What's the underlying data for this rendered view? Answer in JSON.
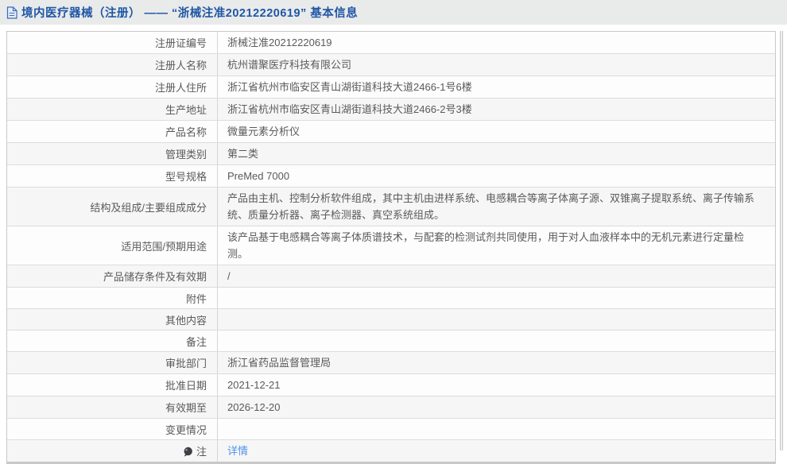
{
  "header": {
    "icon": "document-icon",
    "title": "境内医疗器械（注册） —— “浙械注准20212220619” 基本信息"
  },
  "colors": {
    "header_bg": "#e9eaea",
    "header_text": "#1f57a5",
    "row_even_bg": "#f6f6f7",
    "row_odd_bg": "#fdfdfe",
    "border": "#c9c9c9",
    "text": "#5a5a5a",
    "link": "#4f94e8"
  },
  "table": {
    "rows": [
      {
        "label": "注册证编号",
        "value": "浙械注准20212220619"
      },
      {
        "label": "注册人名称",
        "value": "杭州谱聚医疗科技有限公司"
      },
      {
        "label": "注册人住所",
        "value": "浙江省杭州市临安区青山湖街道科技大道2466-1号6楼"
      },
      {
        "label": "生产地址",
        "value": "浙江省杭州市临安区青山湖街道科技大道2466-2号3楼"
      },
      {
        "label": "产品名称",
        "value": "微量元素分析仪"
      },
      {
        "label": "管理类别",
        "value": "第二类"
      },
      {
        "label": "型号规格",
        "value": "PreMed 7000"
      },
      {
        "label": "结构及组成/主要组成成分",
        "value": "产品由主机、控制分析软件组成，其中主机由进样系统、电感耦合等离子体离子源、双锥离子提取系统、离子传输系统、质量分析器、离子检测器、真空系统组成。"
      },
      {
        "label": "适用范围/预期用途",
        "value": "该产品基于电感耦合等离子体质谱技术，与配套的检测试剂共同使用，用于对人血液样本中的无机元素进行定量检测。"
      },
      {
        "label": "产品储存条件及有效期",
        "value": "/"
      },
      {
        "label": "附件",
        "value": ""
      },
      {
        "label": "其他内容",
        "value": ""
      },
      {
        "label": "备注",
        "value": ""
      },
      {
        "label": "审批部门",
        "value": "浙江省药品监督管理局"
      },
      {
        "label": "批准日期",
        "value": "2021-12-21"
      },
      {
        "label": "有效期至",
        "value": "2026-12-20"
      },
      {
        "label": "变更情况",
        "value": ""
      },
      {
        "label": "注",
        "icon": "note-balloon-icon",
        "value": "详情",
        "is_link": true
      }
    ]
  }
}
